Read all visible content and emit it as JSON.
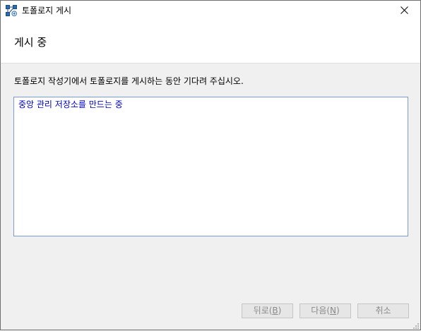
{
  "window": {
    "title": "토폴로지 게시",
    "icon": "topology-app-icon",
    "close_icon": "close-icon"
  },
  "header": {
    "title": "게시 중"
  },
  "description": "토폴로지 작성기에서 토폴로지를 게시하는 동안 기다려 주십시오.",
  "log": {
    "lines": [
      "중앙 관리 저장소를 만드는 중"
    ],
    "text_color": "#0000c8"
  },
  "buttons": {
    "back": {
      "label": "뒤로(",
      "accel": "B",
      "suffix": ")"
    },
    "next": {
      "label": "다음(",
      "accel": "N",
      "suffix": ")"
    },
    "cancel": {
      "label": "취소"
    }
  },
  "colors": {
    "disabled_text": "#8a8a8a",
    "log_border": "#7a9ccf"
  }
}
